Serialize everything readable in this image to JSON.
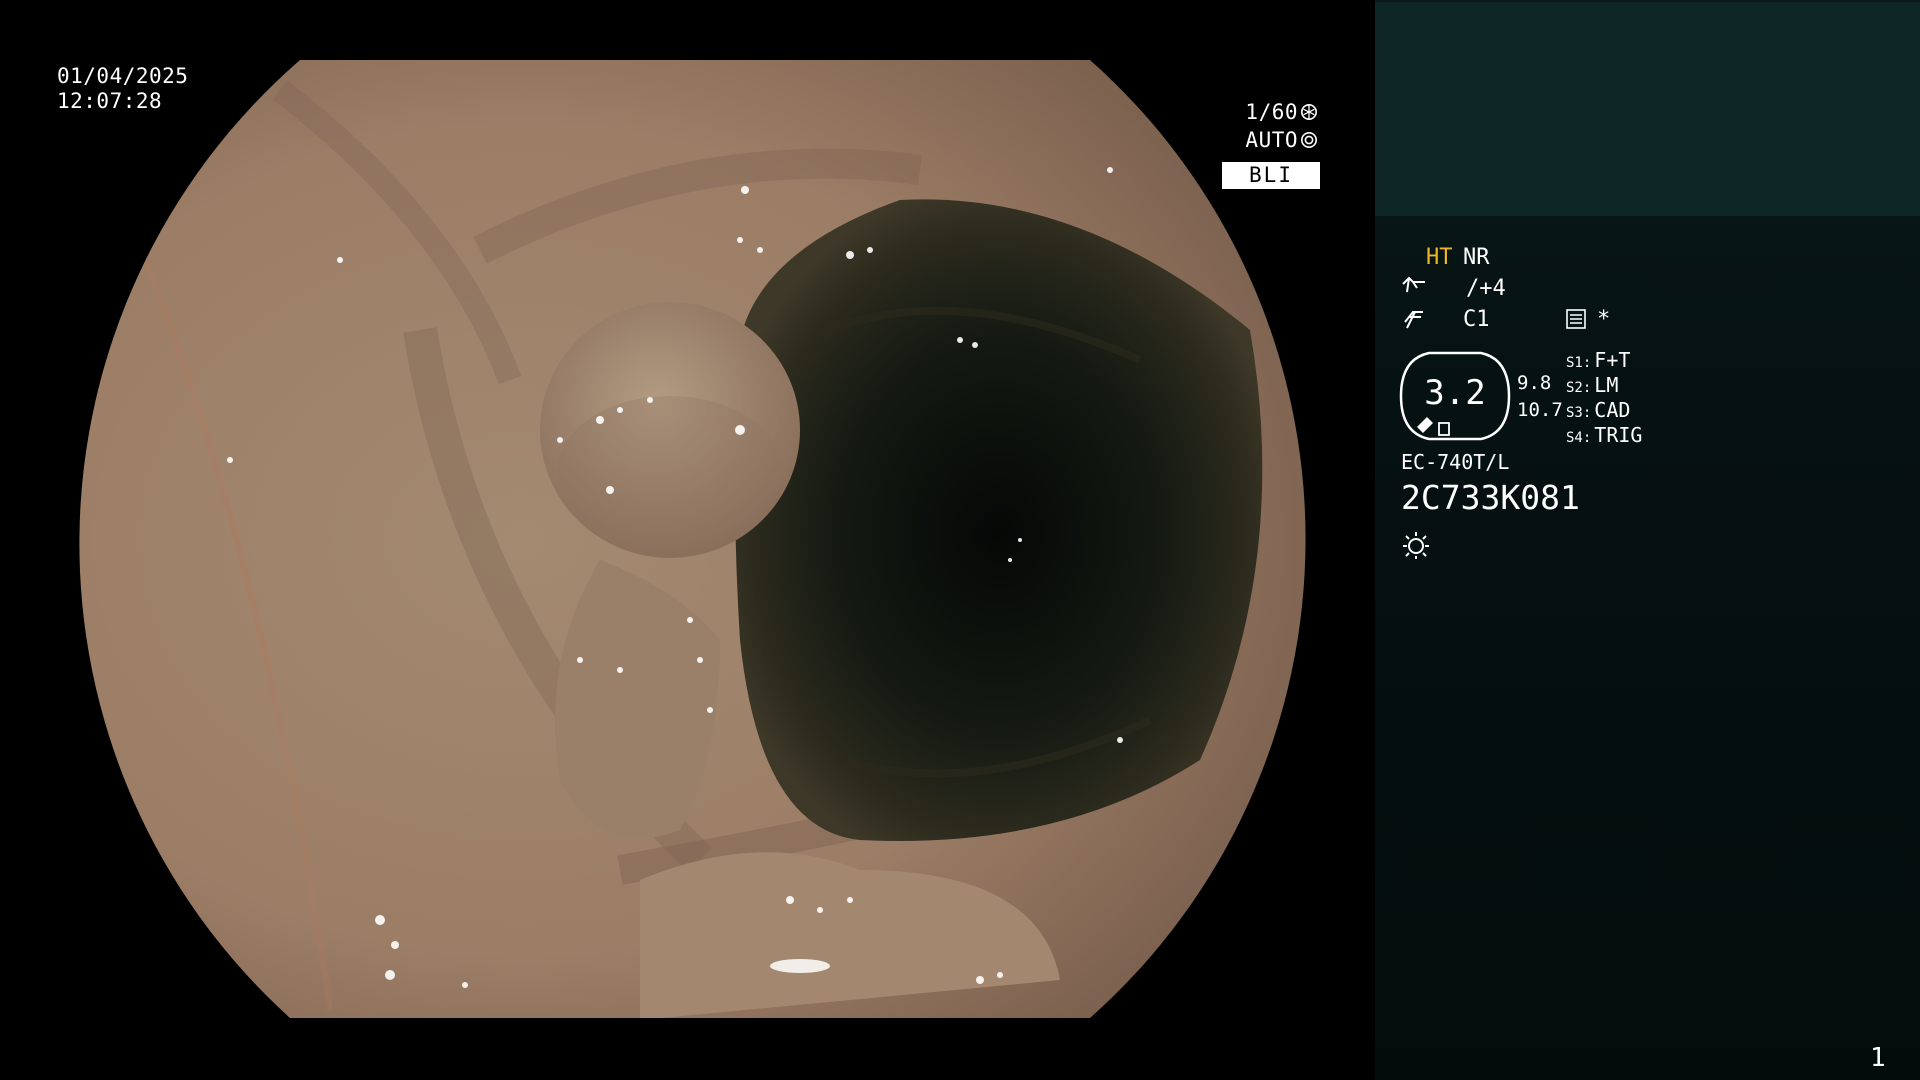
{
  "overlay": {
    "date": "01/04/2025",
    "time": "12:07:28",
    "shutter": "1/60",
    "shutter_icon": "shutter-icon",
    "exposure": "AUTO",
    "exposure_icon": "auto-exposure-icon",
    "mode": "BLI"
  },
  "panel": {
    "ht": "HT",
    "nr": "NR",
    "enhancement_icon": "structure-enhancement-icon",
    "enhancement": "/+4",
    "color_icon": "color-mode-icon",
    "color": "C1",
    "menu_icon": "settings-menu-icon",
    "asterisk": "*",
    "iris_value": "3.2",
    "iris_a": "9.8",
    "iris_b": "10.7",
    "switches": [
      {
        "key": "S1:",
        "value": "F+T"
      },
      {
        "key": "S2:",
        "value": "LM"
      },
      {
        "key": "S3:",
        "value": "CAD"
      },
      {
        "key": "S4:",
        "value": "TRIG"
      }
    ],
    "scope_model": "EC-740T/L",
    "serial": "2C733K081",
    "light_icon": "light-source-icon",
    "page": "1"
  },
  "colors": {
    "accent_ht": "#f0b626",
    "panel_top": "#0f2626",
    "panel_bg": "#061111"
  }
}
